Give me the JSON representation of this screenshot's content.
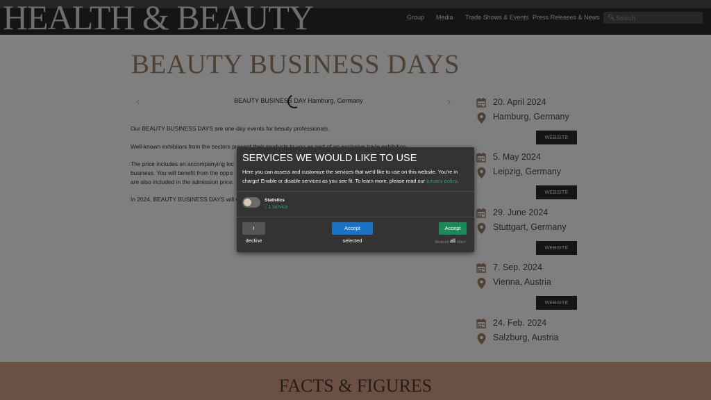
{
  "header": {
    "logo": "HEALTH & BEAUTY",
    "nav": [
      "Group",
      "Media",
      "Trade Shows & Events",
      "Press Releases & News"
    ],
    "search_placeholder": "Search",
    "search_icon": "search-icon"
  },
  "main": {
    "title": "BEAUTY BUSINESS DAYS",
    "hero_alt": "BEAUTY BUSINESS DAY Hamburg, Germany",
    "paragraphs": [
      "Our BEAUTY BUSINESS DAYS are one-day events for beauty professionals.",
      "Well-known exhibitors from the sectors present their products to you as part of an exclusive trade exhibition.",
      "The price includes an accompanying lec",
      "business. You will benefit from the oppo",
      "are also included in the admission price.",
      "In 2024, BEAUTY BUSINESS DAYS will vi"
    ]
  },
  "events": [
    {
      "date": "20. April 2024",
      "place": "Hamburg, Germany",
      "button": "WEBSITE"
    },
    {
      "date": "5. May 2024",
      "place": "Leipzig, Germany",
      "button": "WEBSITE"
    },
    {
      "date": "29. June 2024",
      "place": "Stuttgart, Germany",
      "button": "WEBSITE"
    },
    {
      "date": "7. Sep. 2024",
      "place": "Vienna, Austria",
      "button": "WEBSITE"
    },
    {
      "date": "24. Feb. 2024",
      "place": "Salzburg, Austria"
    }
  ],
  "facts": {
    "title": "FACTS & FIGURES"
  },
  "consent": {
    "title": "SERVICES WE WOULD LIKE TO USE",
    "text": "Here you can assess and customize the services that we'd like to use on this website. You're in charge! Enable or disable services as you see fit. To learn more, please read our ",
    "link": "privacy policy",
    "text_end": ".",
    "category": "Statistics",
    "count": "↓ 1 service",
    "decline": "I decline",
    "accept_selected": "Accept selected",
    "accept_all": "Accept all",
    "realized": "Realized with Klaro!"
  },
  "colors": {
    "accent": "#9d8267",
    "consent_green": "#35a37b",
    "consent_blue": "#1a73c8"
  }
}
